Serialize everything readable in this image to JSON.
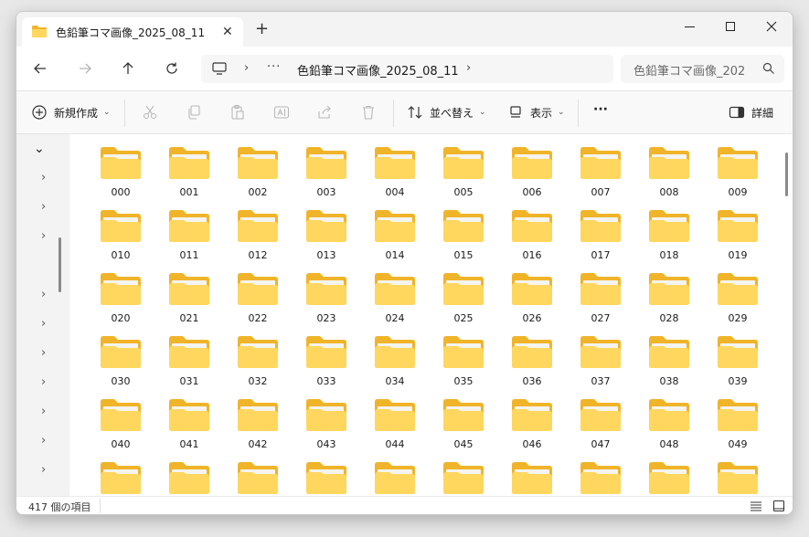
{
  "window": {
    "tab_title": "色鉛筆コマ画像_2025_08_11",
    "tab_close": "✕",
    "new_tab": "+"
  },
  "address": {
    "path_ellipsis": "···",
    "path": "色鉛筆コマ画像_2025_08_11",
    "search_placeholder": "色鉛筆コマ画像_202"
  },
  "commands": {
    "new": "新規作成",
    "sort": "並べ替え",
    "view": "表示",
    "more": "···",
    "details": "詳細"
  },
  "icons": {
    "back": "arrow-left-icon",
    "forward": "arrow-right-icon",
    "up": "arrow-up-icon",
    "refresh": "refresh-icon",
    "cut": "scissors-icon",
    "copy": "copy-icon",
    "paste": "paste-icon",
    "rename": "rename-icon",
    "share": "share-icon",
    "delete": "trash-icon"
  },
  "folders": [
    "000",
    "001",
    "002",
    "003",
    "004",
    "005",
    "006",
    "007",
    "008",
    "009",
    "010",
    "011",
    "012",
    "013",
    "014",
    "015",
    "016",
    "017",
    "018",
    "019",
    "020",
    "021",
    "022",
    "023",
    "024",
    "025",
    "026",
    "027",
    "028",
    "029",
    "030",
    "031",
    "032",
    "033",
    "034",
    "035",
    "036",
    "037",
    "038",
    "039",
    "040",
    "041",
    "042",
    "043",
    "044",
    "045",
    "046",
    "047",
    "048",
    "049",
    "",
    "",
    "",
    "",
    "",
    "",
    "",
    "",
    "",
    ""
  ],
  "status": {
    "item_count": "417 個の項目"
  },
  "colors": {
    "folder_back": "#f0b429",
    "folder_front": "#ffd75e",
    "paper": "#f4f4f0"
  }
}
